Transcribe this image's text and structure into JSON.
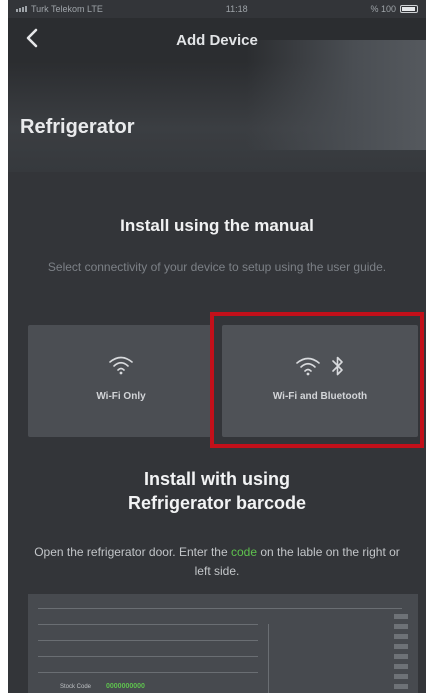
{
  "status_bar": {
    "carrier": "Turk Telekom LTE",
    "time": "11:18",
    "battery": "% 100"
  },
  "header": {
    "title": "Add Device",
    "back_icon": "chevron-left-icon"
  },
  "hero": {
    "title": "Refrigerator"
  },
  "manual_section": {
    "title": "Install using the manual",
    "description": "Select connectivity of your device to setup using the user guide.",
    "options": [
      {
        "label": "Wi-Fi Only",
        "icons": [
          "wifi-icon"
        ]
      },
      {
        "label": "Wi-Fi and Bluetooth",
        "icons": [
          "wifi-icon",
          "bluetooth-icon"
        ],
        "highlighted": true
      }
    ]
  },
  "barcode_section": {
    "title_line1": "Install with using",
    "title_line2": "Refrigerator barcode",
    "description_before": "Open the refrigerator door. Enter the ",
    "description_code": "code",
    "description_after": " on the lable on the right or left side.",
    "stock_label": "Stock Code",
    "stock_value": "0000000000"
  },
  "colors": {
    "highlight": "#c2101a",
    "code_accent": "#5ec24e",
    "background": "#333539"
  }
}
